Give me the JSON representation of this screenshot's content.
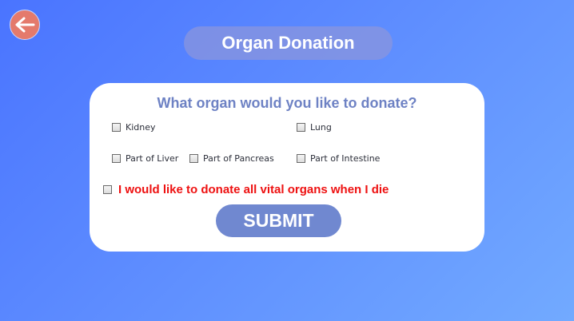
{
  "header": {
    "back_icon": "arrow-left-icon",
    "title": "Organ Donation"
  },
  "form": {
    "question": "What organ would you like to donate?",
    "options": [
      {
        "label": "Kidney",
        "checked": false
      },
      {
        "label": "Lung",
        "checked": false
      },
      {
        "label": "Part of Liver",
        "checked": false
      },
      {
        "label": "Part of Pancreas",
        "checked": false
      },
      {
        "label": "Part of Intestine",
        "checked": false
      }
    ],
    "all_vital_label": "I would like to donate all vital organs when I die",
    "all_vital_checked": false,
    "submit_label": "SUBMIT"
  },
  "colors": {
    "background_start": "#4a74ff",
    "background_end": "#72aaff",
    "back_button": "#e47a6c",
    "title_pill": "#8c96dc",
    "question_text": "#6e82c4",
    "warning_text": "#ee1111",
    "submit_button": "#7088d0"
  }
}
